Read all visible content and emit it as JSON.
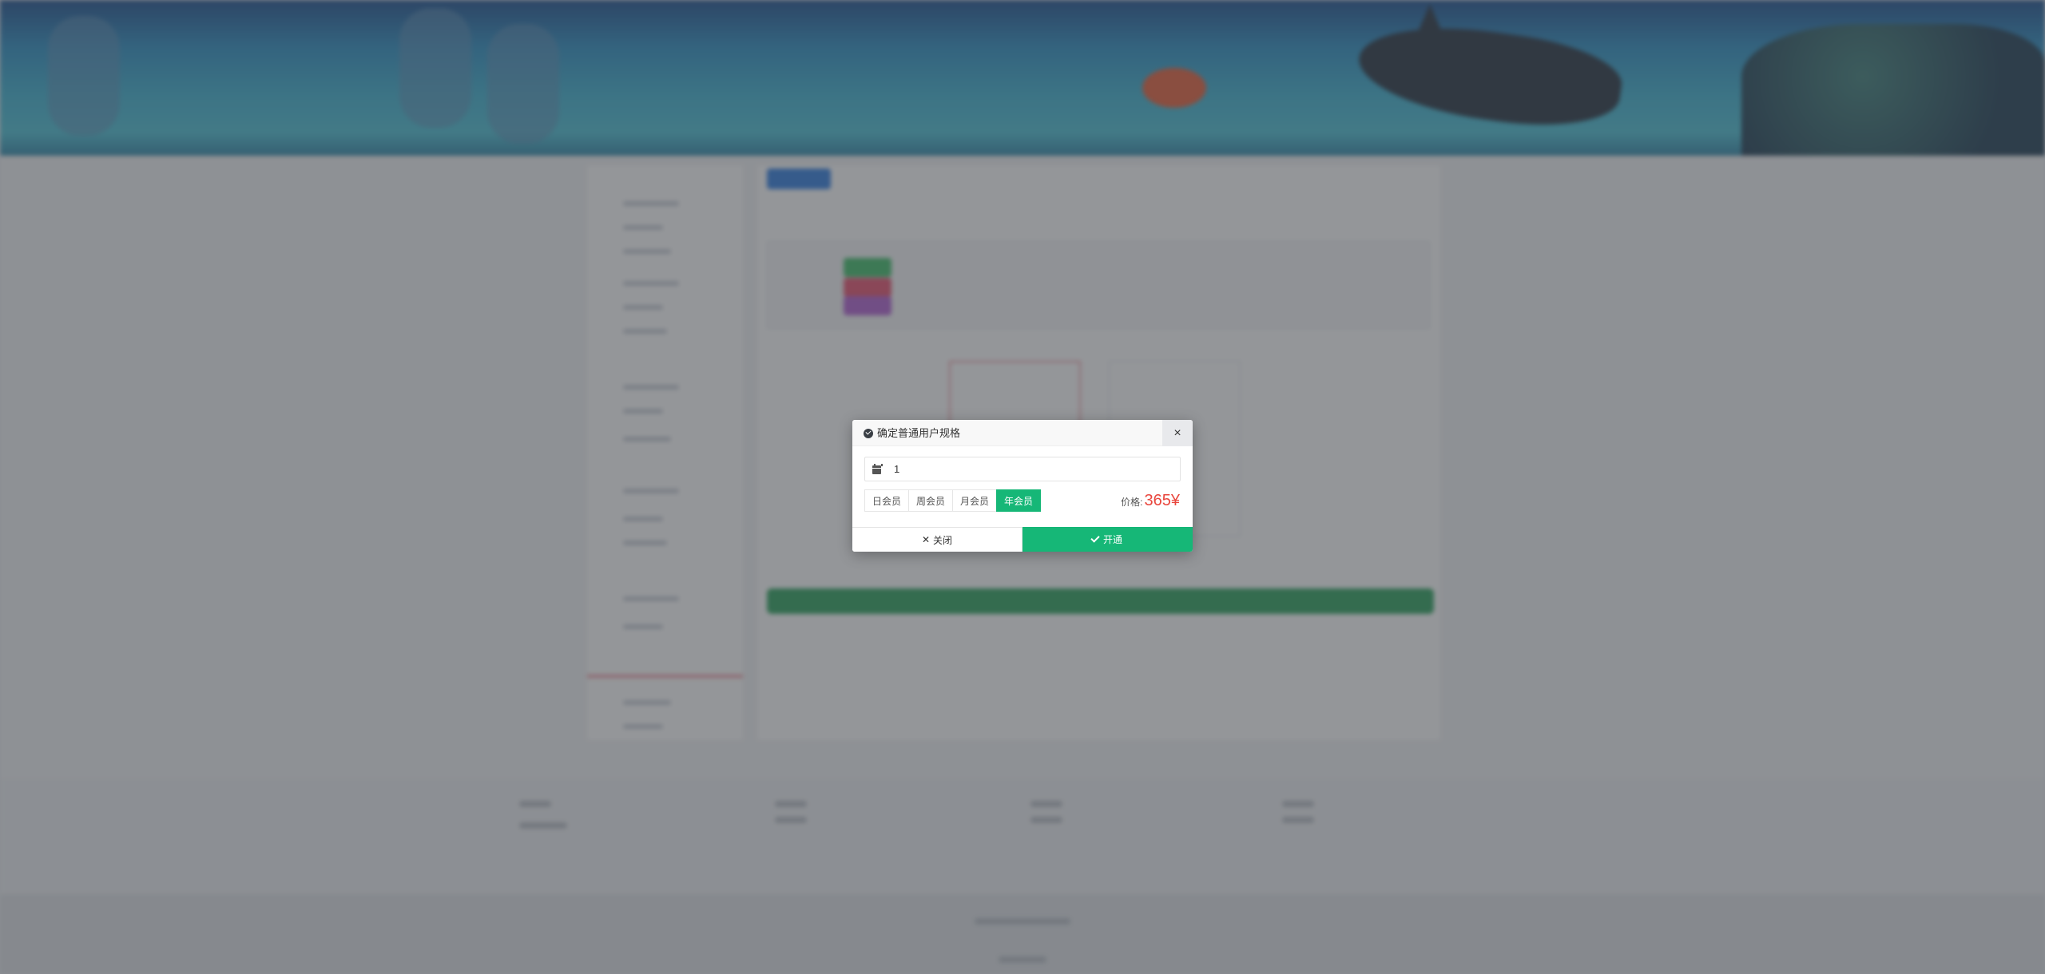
{
  "dialog": {
    "title": "确定普通用户规格",
    "close_icon": "×",
    "quantity_value": "1",
    "plans": [
      {
        "label": "日会员",
        "selected": false
      },
      {
        "label": "周会员",
        "selected": false
      },
      {
        "label": "月会员",
        "selected": false
      },
      {
        "label": "年会员",
        "selected": true
      }
    ],
    "price_label": "价格:",
    "price_value": "365¥",
    "close_button_icon": "✕",
    "close_button_label": "关闭",
    "confirm_button_label": "开通"
  },
  "colors": {
    "accent_green": "#16b777",
    "price_red": "#e9463d",
    "overlay": "rgba(60,64,70,0.55)"
  },
  "icons": [
    "check-circle-icon",
    "close-icon",
    "calendar-icon",
    "x-icon",
    "checkmark-icon"
  ]
}
